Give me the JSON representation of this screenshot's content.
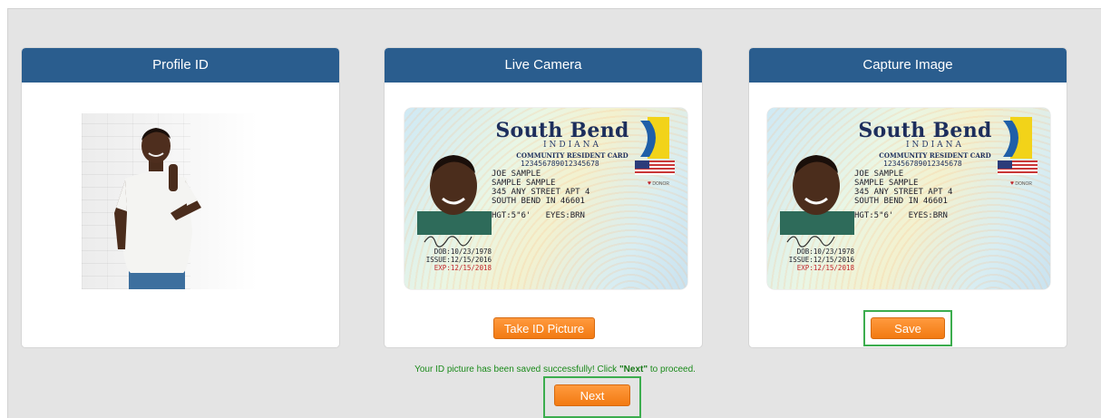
{
  "panels": {
    "profile": {
      "title": "Profile ID"
    },
    "live": {
      "title": "Live Camera",
      "button": "Take ID Picture"
    },
    "capture": {
      "title": "Capture Image",
      "button": "Save"
    }
  },
  "id_card": {
    "title": "South Bend",
    "state": "INDIANA",
    "subtitle": "COMMUNITY RESIDENT CARD",
    "number": "12345678901234​5678",
    "name_lines": "JOE SAMPLE\nSAMPLE SAMPLE\n345 ANY STREET APT 4\nSOUTH BEND IN 46601",
    "physical": "HGT:5\"6'   EYES:BRN",
    "dob": "DOB:10/23/1978",
    "issue": "ISSUE:12/15/2016",
    "exp": "EXP:12/15/2018",
    "donor": "DONOR"
  },
  "status": {
    "message_prefix": "Your ID picture has been saved successfully! Click ",
    "message_highlight": "\"Next\"",
    "message_suffix": " to proceed."
  },
  "next_button": "Next",
  "colors": {
    "header": "#2a5d8e",
    "button": "#f27a12",
    "highlight": "#3cad4e",
    "success_text": "#1a8a1a"
  }
}
